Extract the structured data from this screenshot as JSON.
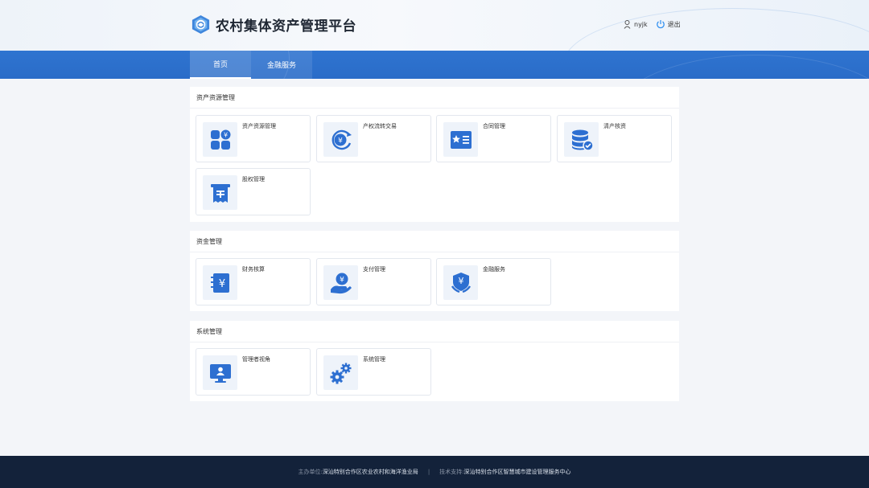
{
  "header": {
    "title": "农村集体资产管理平台",
    "logo_icon": "platform-logo",
    "username": "nyjk",
    "logout_label": "退出"
  },
  "nav": {
    "tabs": [
      {
        "label": "首页",
        "active": true
      },
      {
        "label": "金融服务",
        "active": false
      }
    ]
  },
  "sections": [
    {
      "title": "资产资源管理",
      "cards": [
        {
          "label": "资产资源管理",
          "icon": "grid-yen-icon"
        },
        {
          "label": "产权流转交易",
          "icon": "yen-cycle-icon"
        },
        {
          "label": "合同管理",
          "icon": "contract-card-icon"
        },
        {
          "label": "清产核资",
          "icon": "database-check-icon"
        },
        {
          "label": "股权管理",
          "icon": "receipt-icon"
        }
      ]
    },
    {
      "title": "资金管理",
      "cards": [
        {
          "label": "财务核算",
          "icon": "ledger-yen-icon"
        },
        {
          "label": "支付管理",
          "icon": "hand-coin-icon"
        },
        {
          "label": "金融服务",
          "icon": "shield-yen-icon"
        }
      ]
    },
    {
      "title": "系统管理",
      "cards": [
        {
          "label": "管理者视角",
          "icon": "monitor-user-icon"
        },
        {
          "label": "系统管理",
          "icon": "gears-icon"
        }
      ]
    }
  ],
  "footer": {
    "host_label": "主办单位:",
    "host_value": "深汕特别合作区农业农村和海洋渔业局",
    "separator": "|",
    "tech_label": "技术支持:",
    "tech_value": "深汕特别合作区智慧城市建设管理服务中心"
  },
  "colors": {
    "primary": "#2a6cc8",
    "icon_blue": "#2d6fd1",
    "footer_bg": "#13223a"
  }
}
